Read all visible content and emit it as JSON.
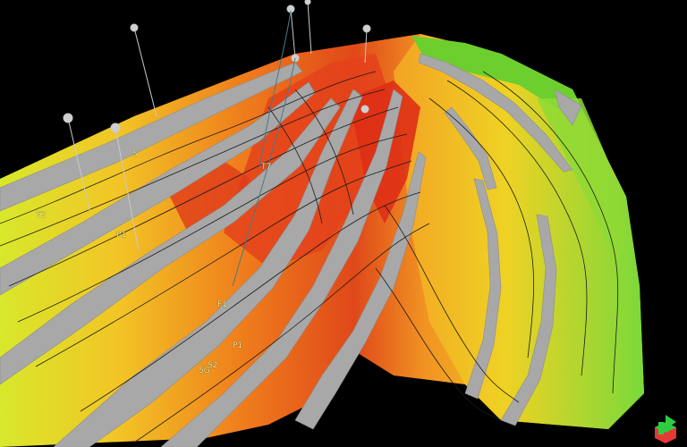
{
  "scene": {
    "background": "#000000",
    "surface_colors": [
      "#d92a14",
      "#ee5a18",
      "#f4891c",
      "#f7b324",
      "#f1dc1d",
      "#d4ee28",
      "#8ee032",
      "#52c82c"
    ],
    "fault_color": "#a7a7a7",
    "contour_color": "#1b1b1b",
    "well_color": "#c9c9c9"
  },
  "annotations": {
    "label_1": "5",
    "label_2": "T2",
    "label_3": "P1",
    "label_4": "T7",
    "label_5": "F1",
    "label_6": "P1",
    "label_7": "S2",
    "label_8": "5G"
  },
  "gizmo": {
    "colors": [
      "#2ecc40",
      "#e53935"
    ]
  }
}
